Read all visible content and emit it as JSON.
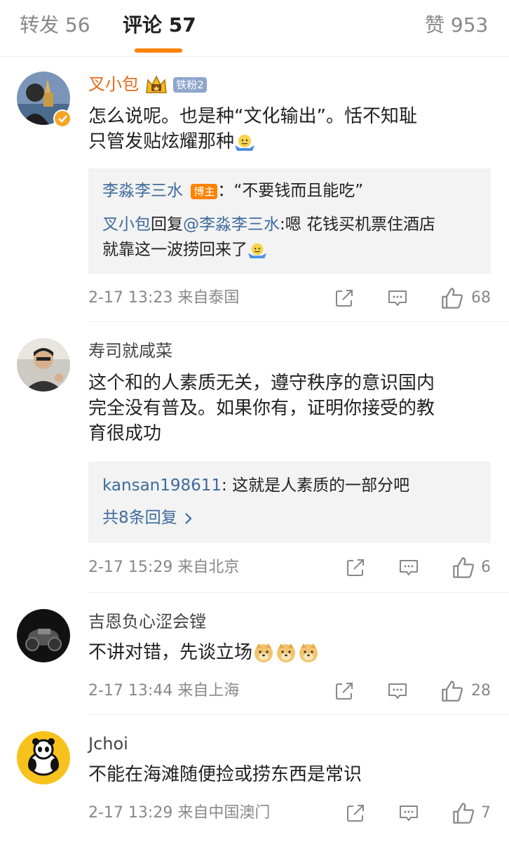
{
  "tabs": {
    "repost": "转发 56",
    "comments": "评论 57",
    "likes": "赞 953"
  },
  "comments": [
    {
      "username": "叉小包",
      "fan_badge": "铁粉2",
      "text_line1": "怎么说呢。也是种“文化输出”。恬不知耻",
      "text_line2": "只管发贴炫耀那种",
      "reply1_user": "李淼李三水",
      "reply1_badge": "博主",
      "reply1_text": "：“不要钱而且能吃”",
      "reply2_user": "叉小包",
      "reply2_mid": "回复",
      "reply2_mention": "@李淼李三水",
      "reply2_text": ":嗯 花钱买机票住酒店",
      "reply2_line2": "就靠这一波捞回来了",
      "meta": "2-17 13:23  来自泰国",
      "likes": "68"
    },
    {
      "username": "寿司就咸菜",
      "text_line1": "这个和的人素质无关，遵守秩序的意识国内",
      "text_line2": "完全没有普及。如果你有，证明你接受的教",
      "text_line3": "育很成功",
      "reply1_user": "kansan198611",
      "reply1_text": ": 这就是人素质的一部分吧",
      "more_replies": "共8条回复",
      "meta": "2-17 15:29  来自北京",
      "likes": "6"
    },
    {
      "username": "吉恩负心涩会镗",
      "text_line1": "不讲对错，先谈立场",
      "meta": "2-17 13:44  来自上海",
      "likes": "28"
    },
    {
      "username": "Jchoi",
      "text_line1": "不能在海滩随便捡或捞东西是常识",
      "meta": "2-17 13:29  来自中国澳门",
      "likes": "7"
    }
  ],
  "icons": [
    "share-icon",
    "comment-icon",
    "like-icon",
    "crown-icon",
    "verified-icon",
    "chevron-right-icon",
    "shrug-emoji-icon",
    "doge-emoji-icon"
  ],
  "colors": {
    "accent": "#ff8200",
    "link": "#3e6b9c",
    "vip_name": "#e86b1a",
    "muted": "#888888"
  }
}
